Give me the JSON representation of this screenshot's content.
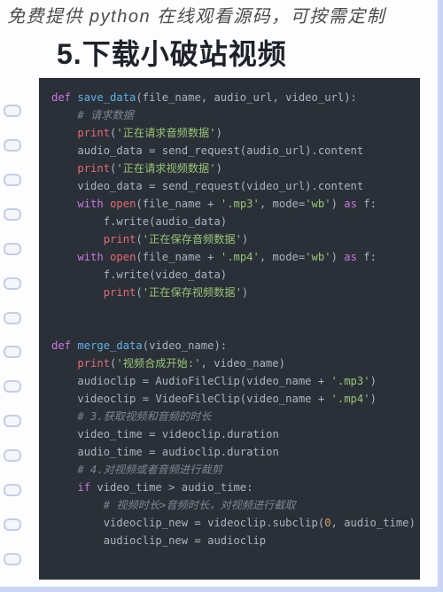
{
  "header": {
    "headline": "免费提供 python 在线观看源码，可按需定制",
    "title": "5.下载小破站视频"
  },
  "code": {
    "save_data": {
      "def_kw": "def",
      "fn_name": "save_data",
      "params": "(file_name, audio_url, video_url):",
      "c1": "# 请求数据",
      "print_kw": "print",
      "s1": "'正在请求音频数据'",
      "line_audio_data": "audio_data = send_request(audio_url).content",
      "s2": "'正在请求视频数据'",
      "line_video_data": "video_data = send_request(video_url).content",
      "with_kw": "with",
      "open_kw": "open",
      "plus_mp3": "(file_name + ",
      "mp3_str": "'.mp3'",
      "mode_arg": ", mode=",
      "wb_str": "'wb'",
      "close_paren": ") ",
      "as_kw": "as",
      "f_var": " f:",
      "write_audio": "f.write(audio_data)",
      "s3": "'正在保存音频数据'",
      "mp4_str": "'.mp4'",
      "write_video": "f.write(video_data)",
      "s4": "'正在保存视频数据'"
    },
    "merge_data": {
      "def_kw": "def",
      "fn_name": "merge_data",
      "params": "(video_name):",
      "print_kw": "print",
      "s1": "'视频合成开始:'",
      "print_tail": ", video_name)",
      "audioclip_line_a": "audioclip = AudioFileClip(video_name + ",
      "mp3_str": "'.mp3'",
      "videoclip_line_a": "videoclip = VideoFileClip(video_name + ",
      "mp4_str": "'.mp4'",
      "close_paren": ")",
      "c3": "# 3.获取视频和音频的时长",
      "vt_line": "video_time = videoclip.duration",
      "at_line": "audio_time = audioclip.duration",
      "c4": "# 4.对视频或者音频进行裁剪",
      "if_kw": "if",
      "if_cond": " video_time > audio_time:",
      "c_sub": "# 视频时长>音频时长，对视频进行截取",
      "vnew_a": "videoclip_new = videoclip.subclip(",
      "zero": "0",
      "vnew_b": ", audio_time)",
      "anew": "audioclip_new = audioclip"
    }
  }
}
